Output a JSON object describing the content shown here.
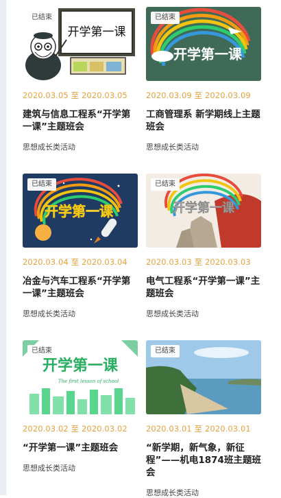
{
  "status_badge": "已结束",
  "date_separator": "至",
  "cards": [
    {
      "start": "2020.03.05",
      "end": "2020.03.05",
      "title": "建筑与信息工程系“开学第一课”主题班会",
      "category": "思想成长类活动",
      "cover_text": "开学第一课"
    },
    {
      "start": "2020.03.09",
      "end": "2020.03.09",
      "title": "工商管理系 新学期线上主题班会",
      "category": "思想成长类活动",
      "cover_text": "开学第一课"
    },
    {
      "start": "2020.03.04",
      "end": "2020.03.04",
      "title": "冶金与汽车工程系“开学第一课”主题班会",
      "category": "思想成长类活动",
      "cover_text": "开学第一课"
    },
    {
      "start": "2020.03.03",
      "end": "2020.03.03",
      "title": "电气工程系“开学第一课”主题班会",
      "category": "思想成长类活动",
      "cover_text": "开学第一课"
    },
    {
      "start": "2020.03.02",
      "end": "2020.03.02",
      "title": "“开学第一课”主题班会",
      "category": "思想成长类活动",
      "cover_text": "开学第一课",
      "cover_subtext": "The first lesson of school"
    },
    {
      "start": "2020.03.01",
      "end": "2020.03.01",
      "title": "“新学期，新气象，新征程”——机电1874班主题班会",
      "category": "思想成长类活动"
    }
  ],
  "colors": {
    "date": "#e6a23c",
    "title": "#222222",
    "category": "#444444"
  }
}
